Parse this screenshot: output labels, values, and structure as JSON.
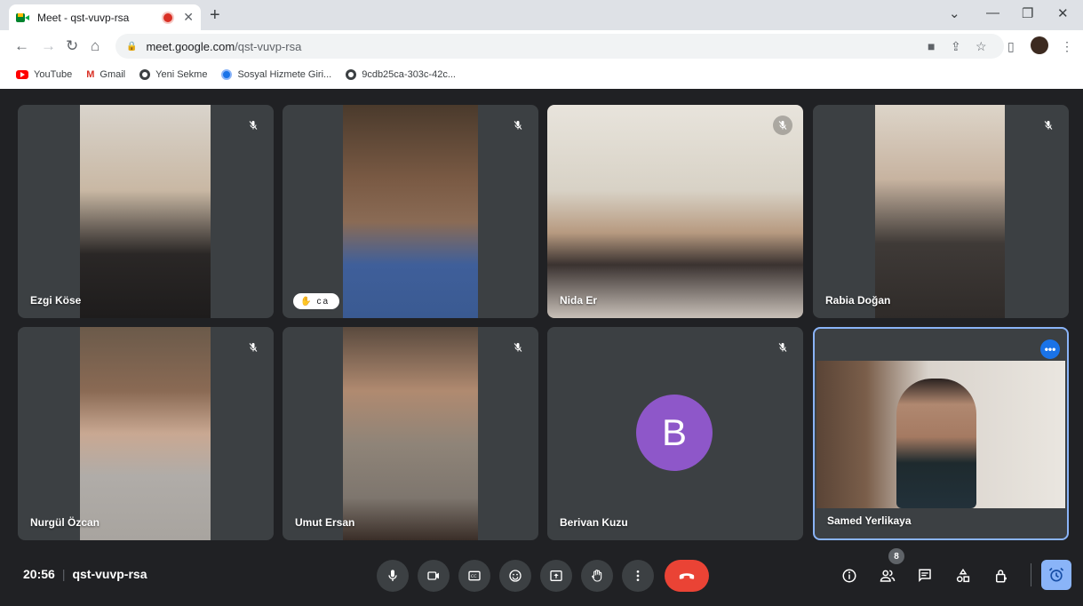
{
  "browser": {
    "tab_title": "Meet - qst-vuvp-rsa",
    "url_domain": "meet.google.com",
    "url_path": "/qst-vuvp-rsa",
    "bookmarks": [
      {
        "label": "YouTube",
        "icon": "youtube-icon"
      },
      {
        "label": "Gmail",
        "icon": "gmail-icon"
      },
      {
        "label": "Yeni Sekme",
        "icon": "globe-icon"
      },
      {
        "label": "Sosyal Hizmete Giri...",
        "icon": "sgk-icon"
      },
      {
        "label": "9cdb25ca-303c-42c...",
        "icon": "globe-icon"
      }
    ]
  },
  "participants": [
    {
      "name": "Ezgi Köse",
      "muted": true
    },
    {
      "name": "",
      "muted": true,
      "chip": "ca"
    },
    {
      "name": "Nida Er",
      "muted": true
    },
    {
      "name": "Rabia Doğan",
      "muted": true
    },
    {
      "name": "Nurgül Özcan",
      "muted": true
    },
    {
      "name": "Umut Ersan",
      "muted": true
    },
    {
      "name": "Berivan Kuzu",
      "muted": true,
      "avatar_letter": "B"
    },
    {
      "name": "Samed Yerlikaya",
      "muted": false,
      "self": true
    }
  ],
  "meeting": {
    "time": "20:56",
    "code": "qst-vuvp-rsa",
    "people_count": "8"
  },
  "colors": {
    "end_call": "#ea4335",
    "accent": "#8ab4f8",
    "avatar": "#8e57c9"
  }
}
